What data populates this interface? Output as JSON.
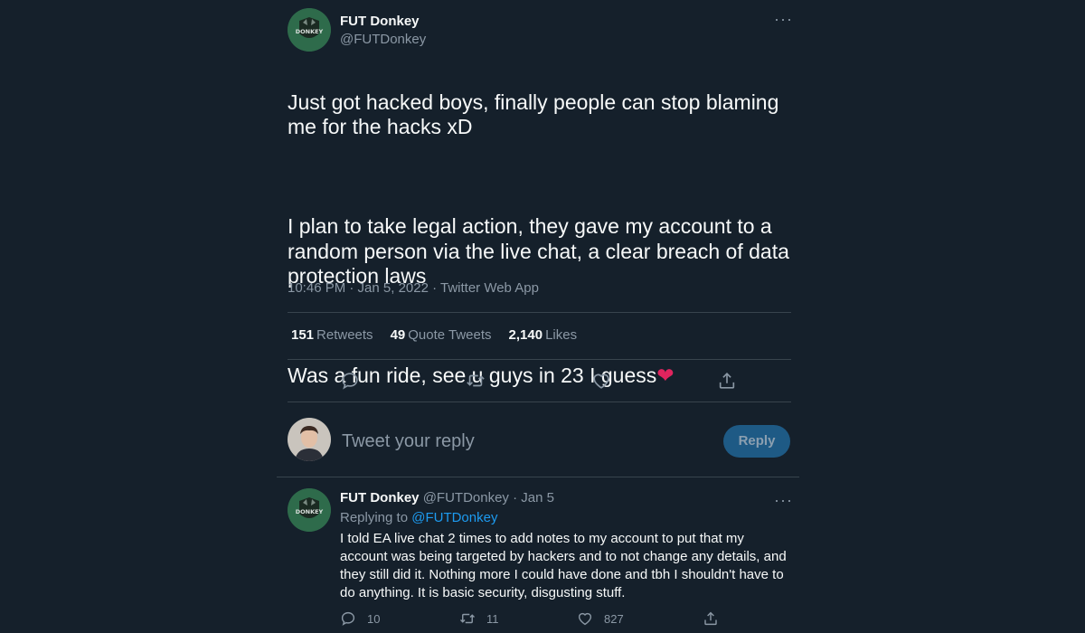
{
  "tweet": {
    "author_name": "FUT Donkey",
    "author_handle": "@FUTDonkey",
    "avatar_text": "DONKEY",
    "text_p1": "Just got hacked boys, finally people can stop blaming me for the hacks xD",
    "text_p2": "I plan to take legal action, they gave my account to a random person via the live chat, a clear breach of data protection laws",
    "text_p3": "Was a fun ride, see u guys in 23 I guess",
    "time": "10:46 PM · Jan 5, 2022 · Twitter Web App",
    "stats": {
      "retweets": "151",
      "retweets_label": "Retweets",
      "quotes": "49",
      "quotes_label": "Quote Tweets",
      "likes": "2,140",
      "likes_label": "Likes"
    }
  },
  "reply_composer": {
    "placeholder": "Tweet your reply",
    "button_label": "Reply"
  },
  "reply": {
    "author_name": "FUT Donkey",
    "author_handle": "@FUTDonkey",
    "date": "· Jan 5",
    "replying_prefix": "Replying to",
    "replying_to": "@FUTDonkey",
    "text": "I told EA live chat 2 times to add notes to my account to put that my account was being targeted by hackers and to not change any details, and they still did it. Nothing more I could have done and tbh I shouldn't have to do anything. It is basic security, disgusting stuff.",
    "replies": "10",
    "retweets": "11",
    "likes": "827"
  },
  "icons": [
    "more-icon",
    "reply-icon",
    "retweet-icon",
    "like-icon",
    "share-icon",
    "heart-emoji-icon"
  ],
  "colors": {
    "background": "#15202b",
    "text": "#f7f9f9",
    "secondary": "#8b98a5",
    "accent": "#1d9bf0",
    "divider": "#38444d",
    "heart": "#e0245e"
  }
}
